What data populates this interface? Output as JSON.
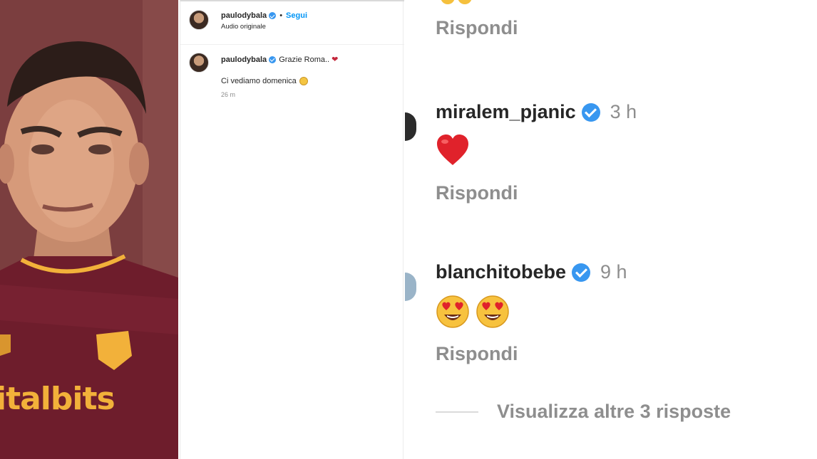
{
  "photo": {
    "sponsor_text": "italbits"
  },
  "post": {
    "username": "paulodybala",
    "separator": "•",
    "follow_label": "Segui",
    "audio_label": "Audio originale",
    "caption": {
      "username": "paulodybala",
      "text": "Grazie Roma..",
      "heart": "❤",
      "line2": "Ci vediamo domenica",
      "time": "26 m"
    }
  },
  "comments": {
    "reply_label": "Rispondi",
    "items": [
      {
        "username": "miralem_pjanic",
        "time": "3 h",
        "emoji": "heart"
      },
      {
        "username": "blanchitobebe",
        "time": "9 h",
        "emoji": "heart-eyes x2"
      }
    ],
    "view_more_label": "Visualizza altre 3 risposte"
  },
  "colors": {
    "verified_blue": "#3897f0",
    "follow_blue": "#0095f6",
    "muted_gray": "#8e8e8e",
    "heart_red": "#e0222b",
    "jersey_maroon": "#7a1f2e",
    "jersey_gold": "#f2b13a"
  }
}
